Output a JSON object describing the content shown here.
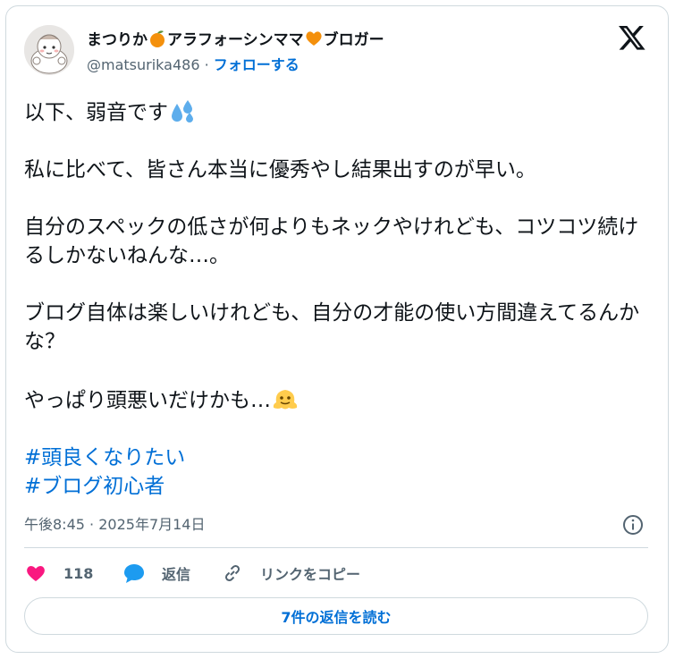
{
  "author": {
    "name_part1": "まつりか",
    "name_part2": "アラフォーシンママ",
    "name_part3": "ブロガー",
    "handle": "@matsurika486",
    "separator": "·",
    "follow_label": "フォローする"
  },
  "tweet": {
    "line1": "以下、弱音です",
    "line2": "私に比べて、皆さん本当に優秀やし結果出すのが早い。",
    "line3": "自分のスペックの低さが何よりもネックやけれども、コツコツ続けるしかないねんな…。",
    "line4": "ブログ自体は楽しいけれども、自分の才能の使い方間違えてるんかな？",
    "line5": "やっぱり頭悪いだけかも…",
    "hashtag1": "#頭良くなりたい",
    "hashtag2": "#ブログ初心者"
  },
  "meta": {
    "time": "午後8:45",
    "separator": "·",
    "date": "2025年7月14日"
  },
  "actions": {
    "like_count": "118",
    "reply_label": "返信",
    "copy_link_label": "リンクをコピー"
  },
  "read_replies_label": "7件の返信を読む",
  "colors": {
    "link": "#006fd6",
    "like": "#f91880",
    "reply_icon": "#1d9bf0",
    "muted": "#536471",
    "border": "#cfd9de"
  },
  "icons": {
    "emoji1": "tangerine-icon",
    "emoji2": "orange-heart-icon",
    "emoji3": "sweat-droplets-icon",
    "emoji4": "melting-face-icon"
  }
}
